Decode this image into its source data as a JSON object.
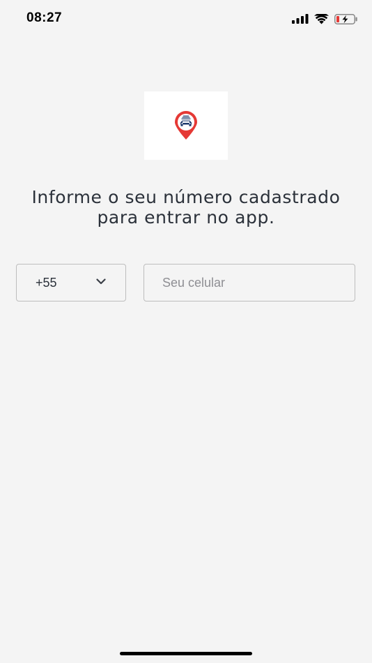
{
  "status_bar": {
    "time": "08:27",
    "icons": [
      "signal-icon",
      "wifi-icon",
      "battery-charging-icon"
    ],
    "battery_color": "#e53935"
  },
  "logo": {
    "icon": "map-pin-car-logo",
    "pin_color": "#e53935",
    "car_color": "#1f3a6d"
  },
  "prompt": {
    "line1": "Informe o seu número cadastrado",
    "line2": "para entrar no app."
  },
  "phone_form": {
    "country_code": {
      "selected": "+55",
      "icon": "chevron-down-icon"
    },
    "phone_input": {
      "value": "",
      "placeholder": "Seu celular"
    }
  },
  "colors": {
    "background": "#f4f4f4",
    "text": "#2b313a",
    "border": "#bdbdbd",
    "placeholder": "#8e8e93"
  }
}
